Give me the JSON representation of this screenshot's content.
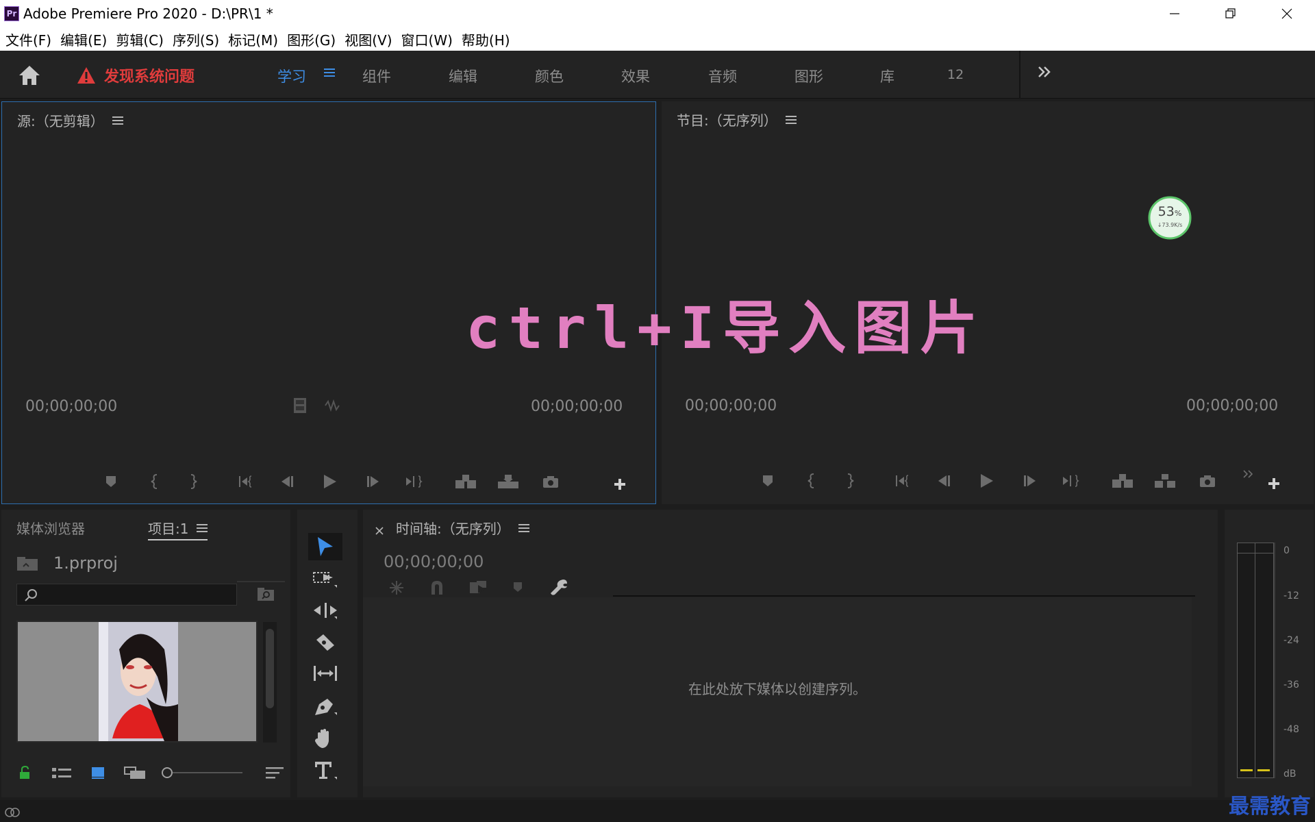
{
  "window": {
    "title": "Adobe Premiere Pro 2020 - D:\\PR\\1 *",
    "app_icon_label": "Pr"
  },
  "menu": [
    "文件(F)",
    "编辑(E)",
    "剪辑(C)",
    "序列(S)",
    "标记(M)",
    "图形(G)",
    "视图(V)",
    "窗口(W)",
    "帮助(H)"
  ],
  "workspace": {
    "warning_text": "发现系统问题",
    "tabs": [
      "学习",
      "组件",
      "编辑",
      "颜色",
      "效果",
      "音频",
      "图形",
      "库",
      "12"
    ],
    "active_tab": "学习"
  },
  "source": {
    "title": "源:（无剪辑）",
    "tc_left": "00;00;00;00",
    "tc_right": "00;00;00;00"
  },
  "program": {
    "title": "节目:（无序列）",
    "tc_left": "00;00;00;00",
    "tc_right": "00;00;00;00"
  },
  "progress": {
    "percent": "53",
    "percent_sign": "%",
    "speed": "↓73.9K/s"
  },
  "overlay_text": "ctrl+I导入图片",
  "project": {
    "tab_media_browser": "媒体浏览器",
    "tab_project": "项目:1",
    "file_name": "1.prproj"
  },
  "timeline": {
    "title": "时间轴:（无序列）",
    "timecode": "00;00;00;00",
    "empty_message": "在此处放下媒体以创建序列。"
  },
  "meter": {
    "labels": [
      "0",
      "-12",
      "-24",
      "-36",
      "-48",
      "dB"
    ]
  },
  "watermark": "最需教育",
  "colors": {
    "accent": "#3e8ee6",
    "warning": "#e03c3c",
    "overlay": "#e17fc0",
    "panel_bg": "#232323"
  }
}
